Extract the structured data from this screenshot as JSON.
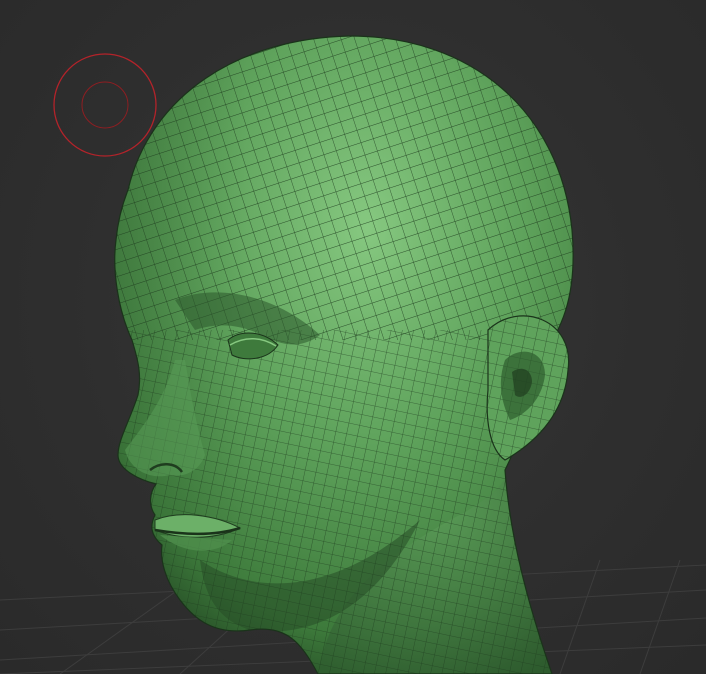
{
  "viewport": {
    "background_color": "#2f2f2f",
    "grid_color": "#3d3d3d"
  },
  "model": {
    "name": "head-mesh",
    "base_color": "#5fa35c",
    "shadow_color": "#2e5c2e",
    "highlight_color": "#7fc47a",
    "wire_color": "#1f3d1f"
  },
  "brush_cursor": {
    "outer_color": "#b3232a",
    "inner_color": "#8e1e22"
  }
}
